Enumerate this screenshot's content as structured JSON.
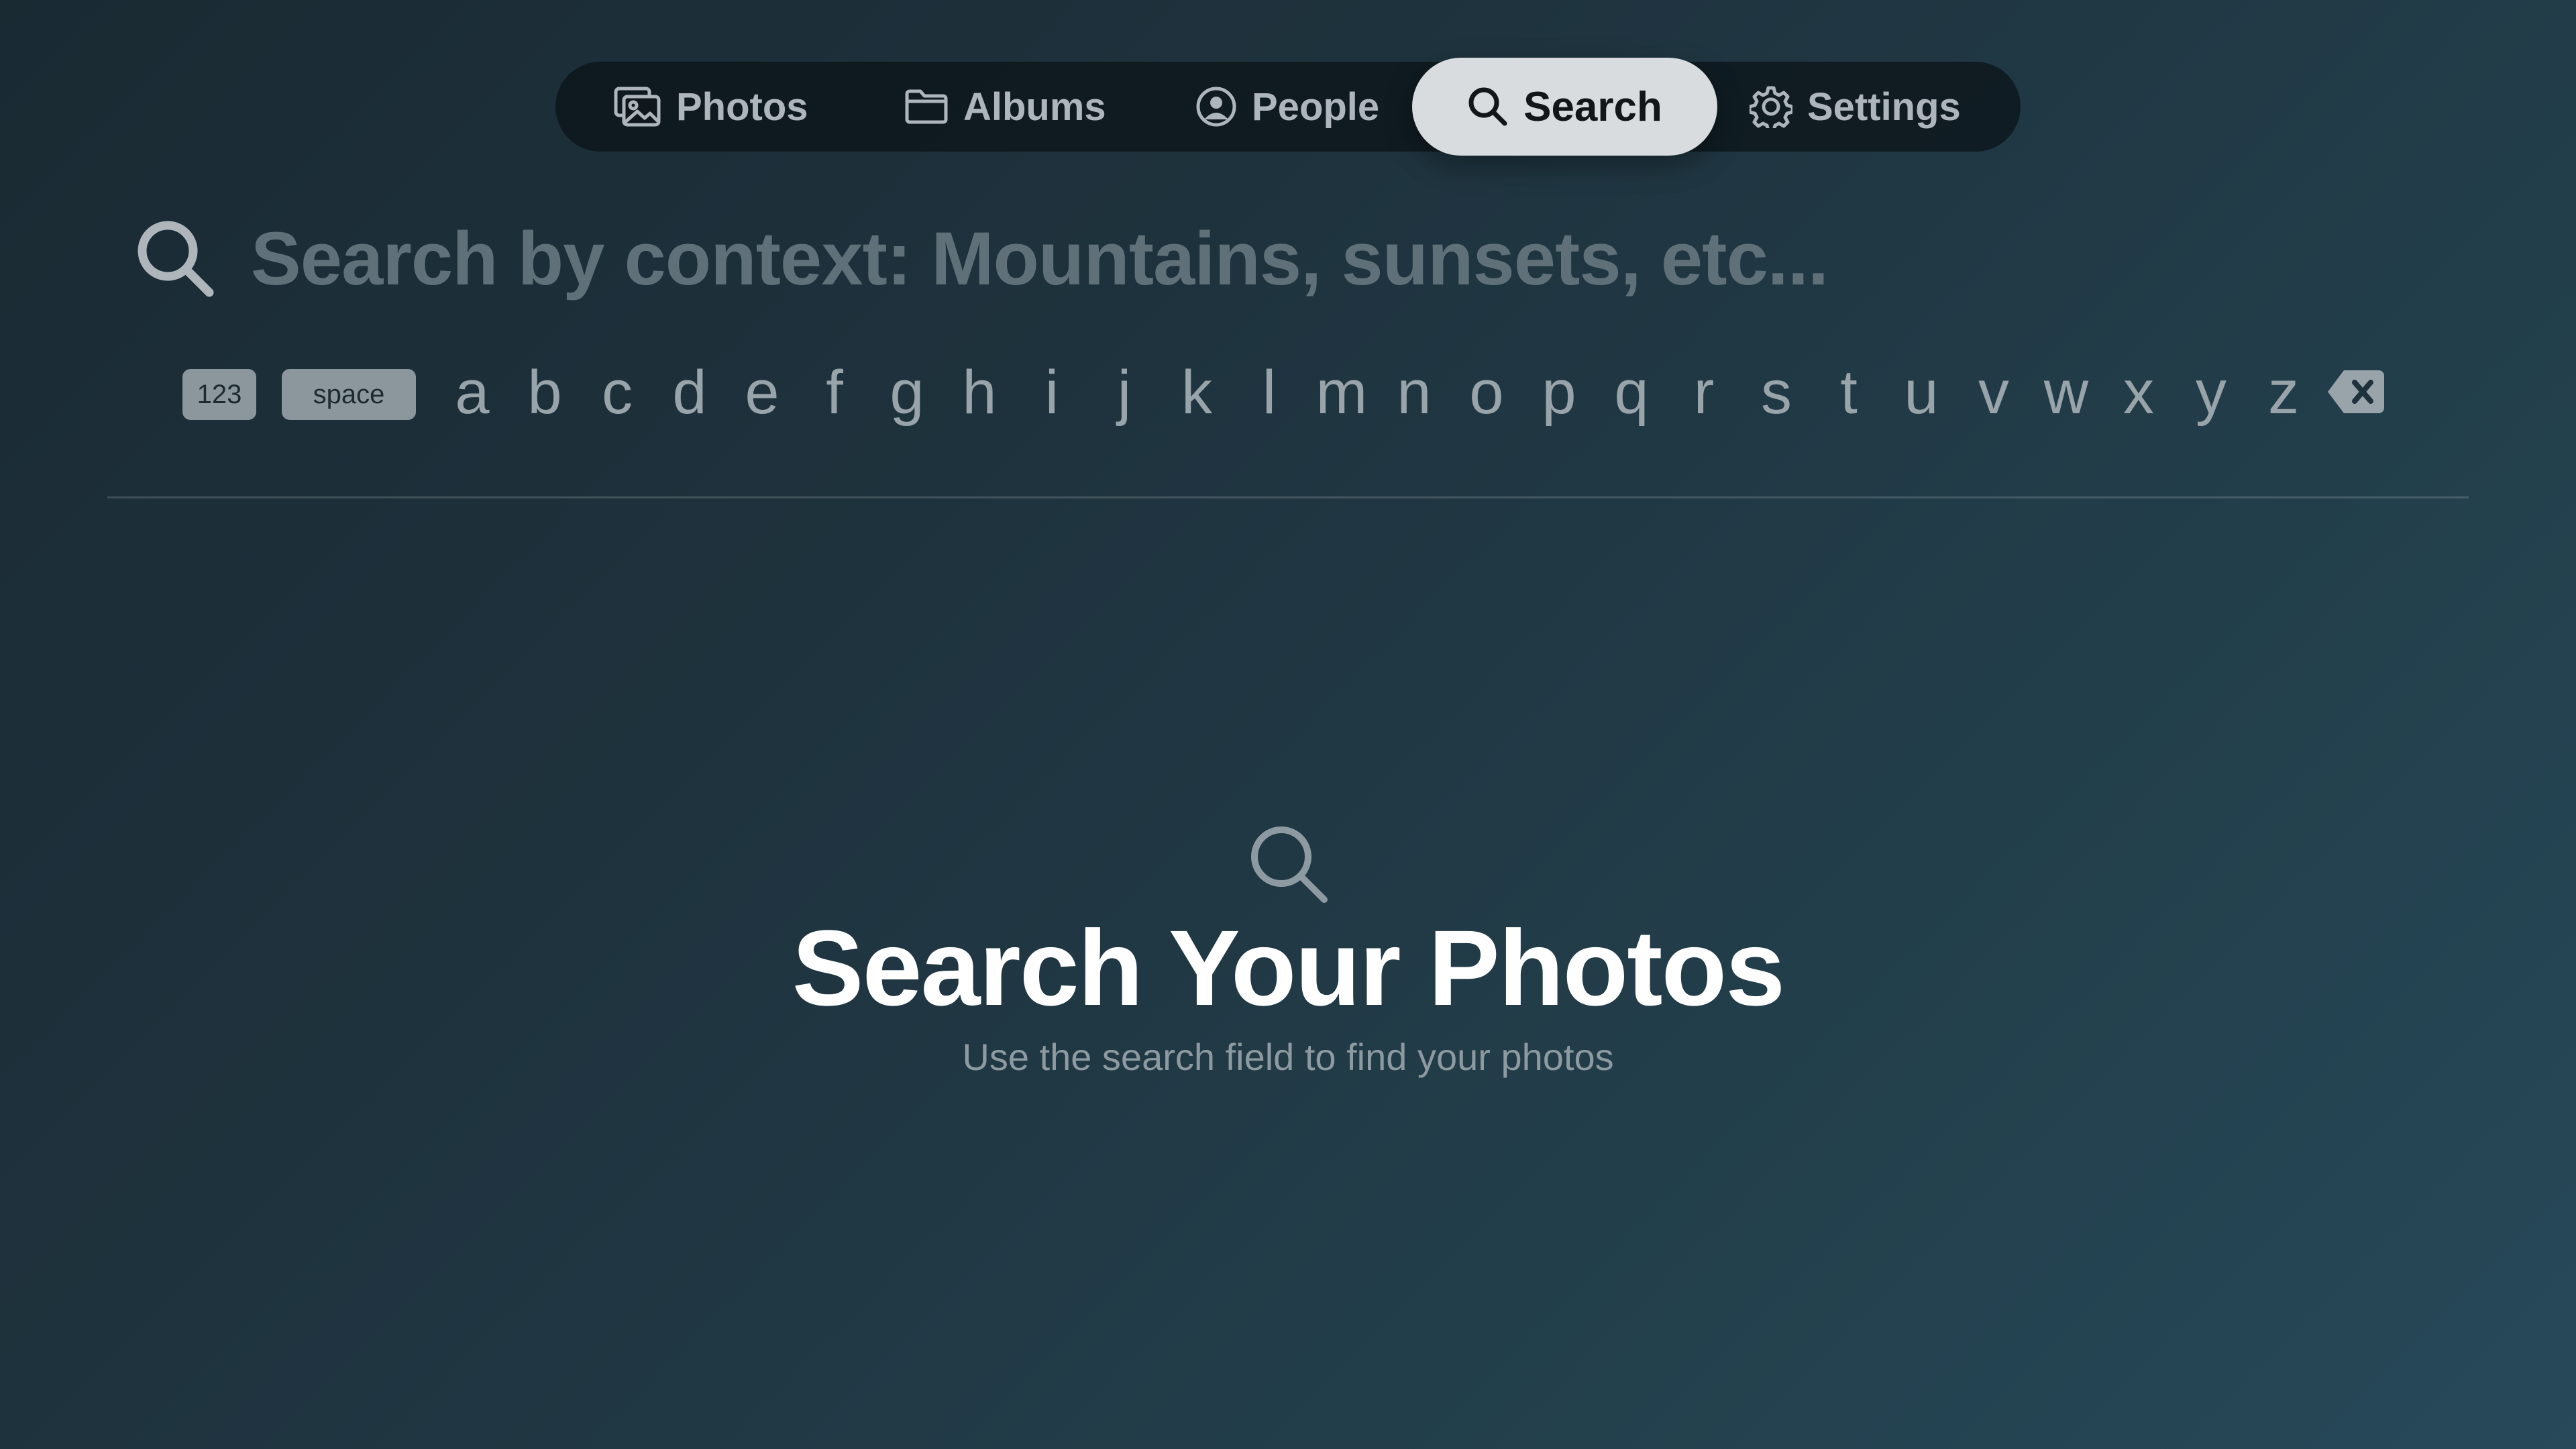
{
  "tabs": {
    "photos": "Photos",
    "albums": "Albums",
    "people": "People",
    "search": "Search",
    "settings": "Settings",
    "active": "Search"
  },
  "search": {
    "placeholder": "Search by context: Mountains, sunsets, etc..."
  },
  "keyboard": {
    "numbers_key": "123",
    "space_key": "space",
    "letters": [
      "a",
      "b",
      "c",
      "d",
      "e",
      "f",
      "g",
      "h",
      "i",
      "j",
      "k",
      "l",
      "m",
      "n",
      "o",
      "p",
      "q",
      "r",
      "s",
      "t",
      "u",
      "v",
      "w",
      "x",
      "y",
      "z"
    ]
  },
  "empty_state": {
    "title": "Search Your Photos",
    "subtitle": "Use the search field to find your photos"
  },
  "icons": {
    "photos": "photos-icon",
    "albums": "folder-icon",
    "people": "person-circle-icon",
    "search": "search-icon",
    "settings": "gear-icon",
    "delete": "delete-backspace-icon"
  },
  "colors": {
    "active_tab_bg": "#d9dcdf",
    "tabbar_bg": "#0c141a",
    "placeholder": "#5f7079",
    "key_pill": "#8c979d"
  }
}
